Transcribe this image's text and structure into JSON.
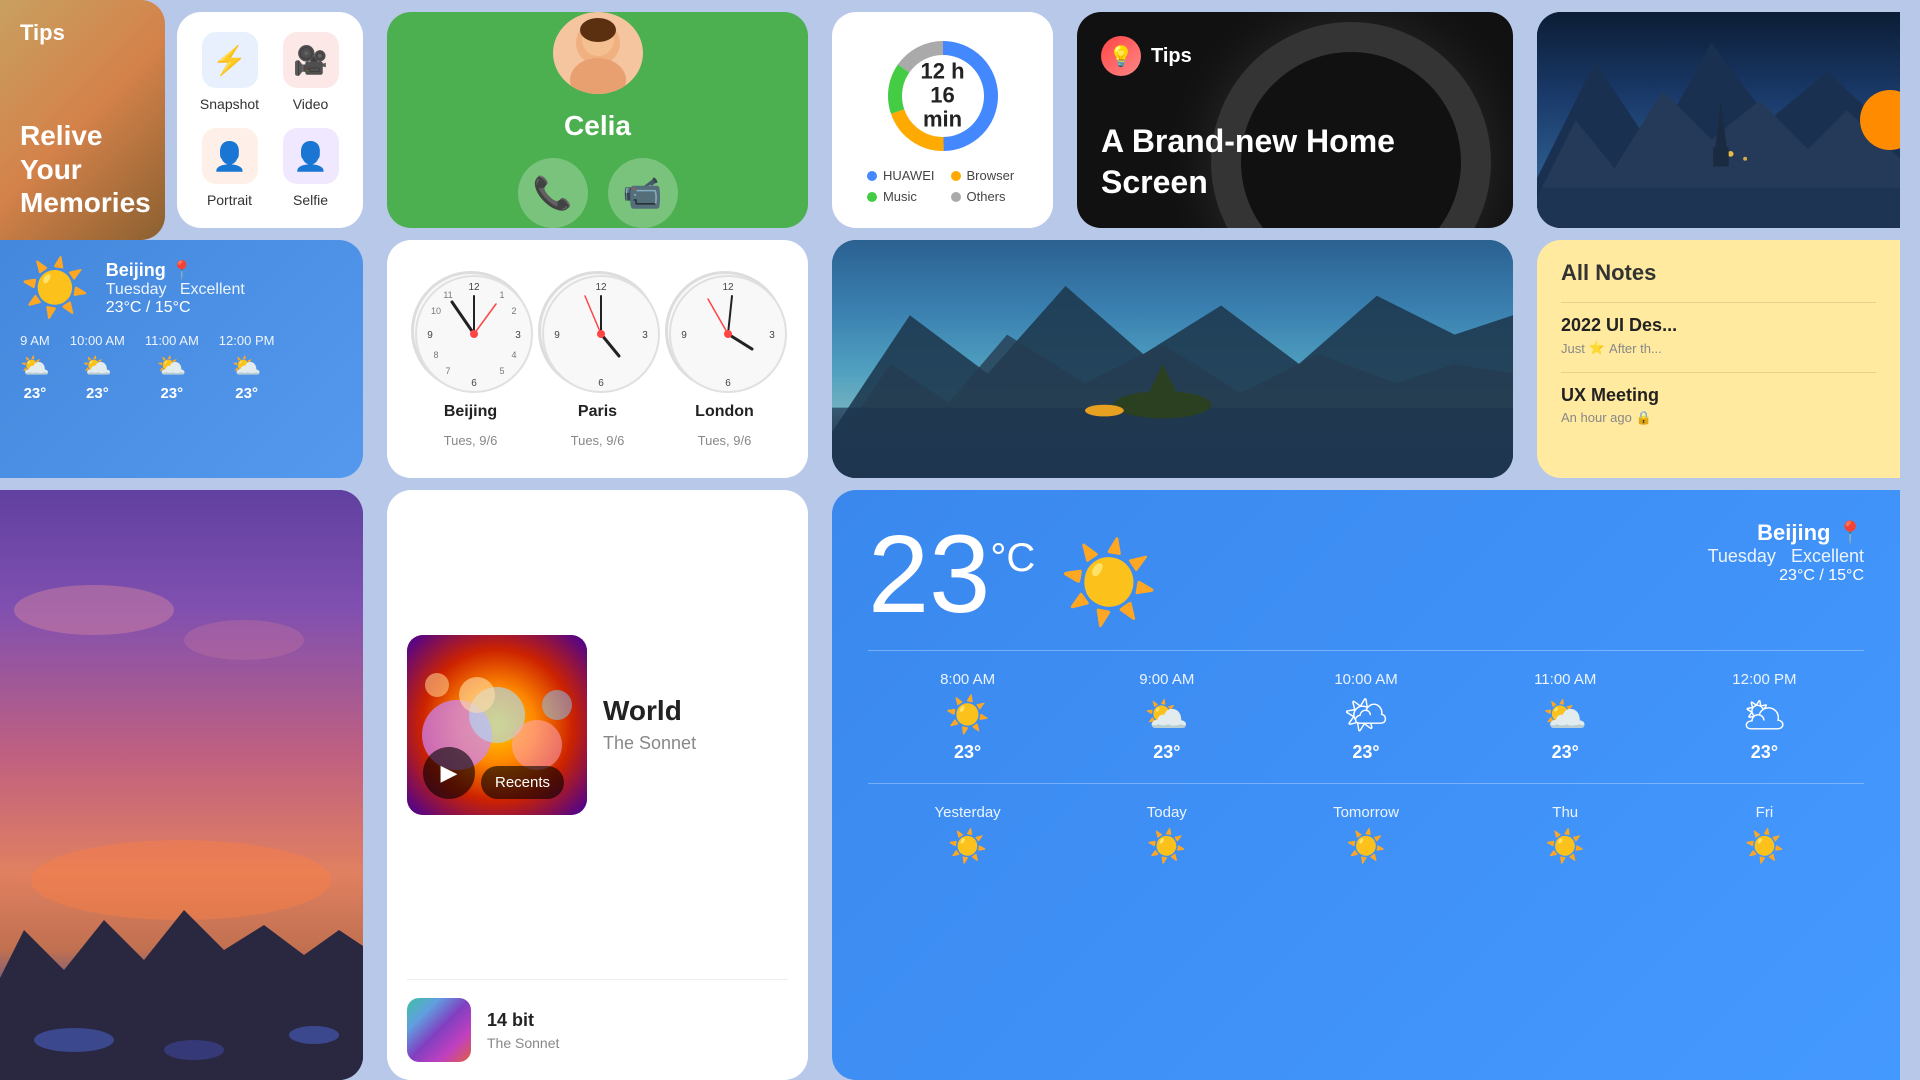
{
  "tips_landscape": {
    "label": "Tips",
    "memories_text": "Relive Your Memories"
  },
  "camera_grid": {
    "items": [
      {
        "label": "Snapshot",
        "icon": "⚡",
        "bg": "icon-blue"
      },
      {
        "label": "Video",
        "icon": "🎥",
        "bg": "icon-red"
      },
      {
        "label": "Portrait",
        "icon": "👤",
        "bg": "icon-orange"
      },
      {
        "label": "Selfie",
        "icon": "👤",
        "bg": "icon-purple"
      }
    ]
  },
  "celia": {
    "name": "Celia",
    "call_icon": "📞",
    "video_icon": "📹"
  },
  "battery": {
    "hours": "12 h",
    "minutes": "16 min",
    "legend": [
      {
        "label": "HUAWEI",
        "color": "#4488ff"
      },
      {
        "label": "Browser",
        "color": "#ffaa00"
      },
      {
        "label": "Music",
        "color": "#44cc44"
      },
      {
        "label": "Others",
        "color": "#aaaaaa"
      }
    ]
  },
  "tips_dark": {
    "label": "Tips",
    "subtitle": "A Brand-new Home Screen"
  },
  "weather_small": {
    "city": "Beijing",
    "day": "Tuesday",
    "condition": "Excellent",
    "temp_range": "23°C / 15°C",
    "hourly": [
      {
        "time": "9 AM",
        "icon": "⛅",
        "temp": "23°"
      },
      {
        "time": "10:00 AM",
        "icon": "⛅",
        "temp": "23°"
      },
      {
        "time": "11:00 AM",
        "icon": "⛅",
        "temp": "23°"
      },
      {
        "time": "12:00 PM",
        "icon": "⛅",
        "temp": "23°"
      }
    ]
  },
  "clocks": [
    {
      "city": "Beijing",
      "date": "Tues, 9/6",
      "hour_angle": 60,
      "minute_angle": 0,
      "second_angle": 0
    },
    {
      "city": "Paris",
      "date": "Tues, 9/6",
      "hour_angle": 0,
      "minute_angle": 30,
      "second_angle": 180
    },
    {
      "city": "London",
      "date": "Tues, 9/6",
      "hour_angle": 330,
      "minute_angle": 60,
      "second_angle": 90
    }
  ],
  "notes": {
    "header": "All Notes",
    "items": [
      {
        "title": "2022 UI Des...",
        "meta": "Just ⭐ After th..."
      },
      {
        "title": "UX Meeting",
        "meta": "An hour ago 🔒"
      }
    ]
  },
  "music": {
    "top": {
      "title": "World",
      "artist": "The Sonnet",
      "play_label": "▶",
      "recents_label": "Recents"
    },
    "second": {
      "title": "14 bit",
      "artist": "The Sonnet"
    }
  },
  "weather_large": {
    "temp": "23",
    "unit": "°C",
    "city": "Beijing",
    "day": "Tuesday",
    "condition": "Excellent",
    "temp_range": "23°C / 15°C",
    "hourly": [
      {
        "time": "8:00 AM",
        "icon": "☀️",
        "temp": "23°"
      },
      {
        "time": "9:00 AM",
        "icon": "⛅",
        "temp": "23°"
      },
      {
        "time": "10:00 AM",
        "icon": "⛅",
        "temp": "23°"
      },
      {
        "time": "11:00 AM",
        "icon": "⛅",
        "temp": "23°"
      },
      {
        "time": "12:00 PM",
        "icon": "🌥",
        "temp": "23°"
      }
    ],
    "daily": [
      {
        "name": "Yesterday",
        "icon": "☀️"
      },
      {
        "name": "Today",
        "icon": "☀️"
      },
      {
        "name": "Tomorrow",
        "icon": "☀️"
      },
      {
        "name": "Thu",
        "icon": "☀️"
      },
      {
        "name": "Fri",
        "icon": "☀️"
      }
    ]
  }
}
